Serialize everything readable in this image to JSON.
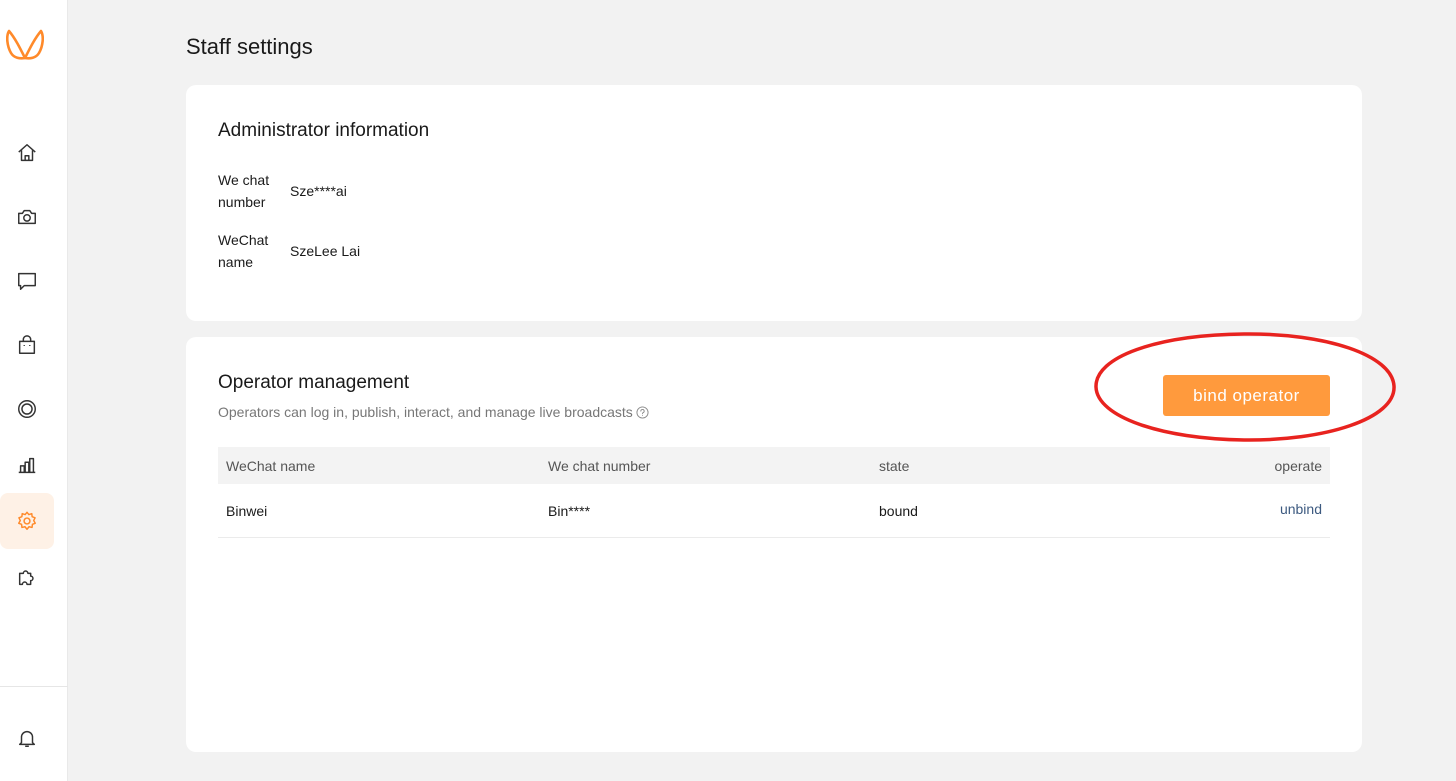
{
  "page": {
    "title": "Staff settings"
  },
  "sidebar": {
    "logo": "butterfly-logo-icon",
    "items": [
      {
        "icon": "home-icon",
        "active": false
      },
      {
        "icon": "camera-icon",
        "active": false
      },
      {
        "icon": "chat-icon",
        "active": false
      },
      {
        "icon": "shopping-bag-icon",
        "active": false
      },
      {
        "icon": "target-icon",
        "active": false
      },
      {
        "icon": "bar-chart-icon",
        "active": false
      },
      {
        "icon": "gear-icon",
        "active": true
      },
      {
        "icon": "puzzle-icon",
        "active": false
      }
    ],
    "bottom": {
      "icon": "bell-icon"
    }
  },
  "admin": {
    "title": "Administrator information",
    "rows": [
      {
        "label": "We chat number",
        "value": "Sze****ai"
      },
      {
        "label": "WeChat name",
        "value": "SzeLee Lai"
      }
    ]
  },
  "operators": {
    "title": "Operator management",
    "subtitle": "Operators can log in, publish, interact, and manage live broadcasts",
    "bind_label": "bind operator",
    "columns": [
      "WeChat name",
      "We chat number",
      "state",
      "operate"
    ],
    "rows": [
      {
        "name": "Binwei",
        "number": "Bin****",
        "state": "bound",
        "action": "unbind"
      }
    ]
  },
  "colors": {
    "accent": "#ff9a3d",
    "annotation": "#e8231f",
    "link": "#3d5a80",
    "active_nav_bg": "#fef1e6"
  }
}
